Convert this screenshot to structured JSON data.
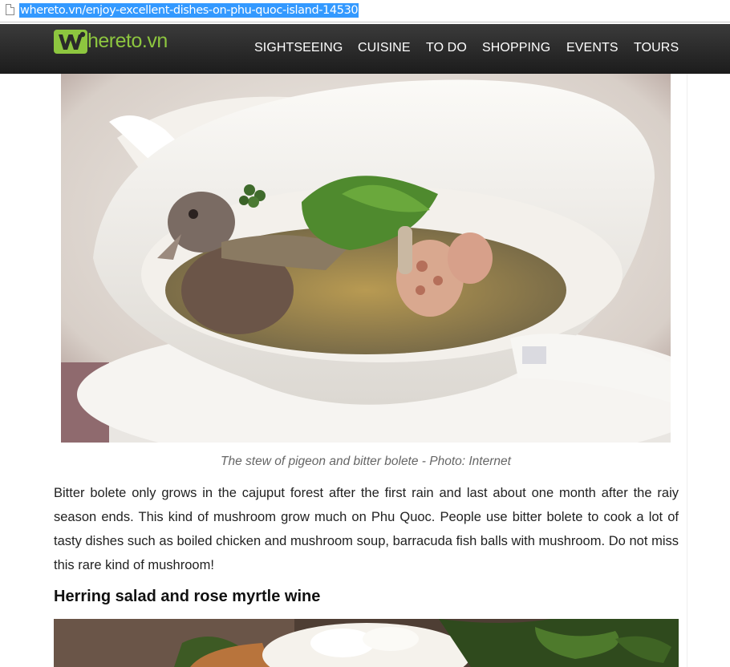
{
  "browser": {
    "url": "whereto.vn/enjoy-excellent-dishes-on-phu-quoc-island-14530",
    "page_icon": "document-icon"
  },
  "site": {
    "logo_text": "hereto.vn",
    "logo_letter": "W",
    "brand_color": "#8dc63f"
  },
  "nav": {
    "items": [
      {
        "label": "SIGHTSEEING"
      },
      {
        "label": "CUISINE"
      },
      {
        "label": "TO DO"
      },
      {
        "label": "SHOPPING"
      },
      {
        "label": "EVENTS"
      },
      {
        "label": "TOURS"
      }
    ]
  },
  "article": {
    "caption": "The stew of pigeon and bitter bolete - Photo: Internet",
    "paragraph": "Bitter bolete only grows in the cajuput forest after the first rain and last about one month after the raiy season ends. This kind of mushroom grow much on Phu Quoc. People use bitter bolete to cook a lot of tasty dishes such as boiled chicken and mushroom soup, barracuda fish balls with mushroom. Do not miss this rare kind of mushroom!",
    "subheading": "Herring salad and rose myrtle wine"
  }
}
